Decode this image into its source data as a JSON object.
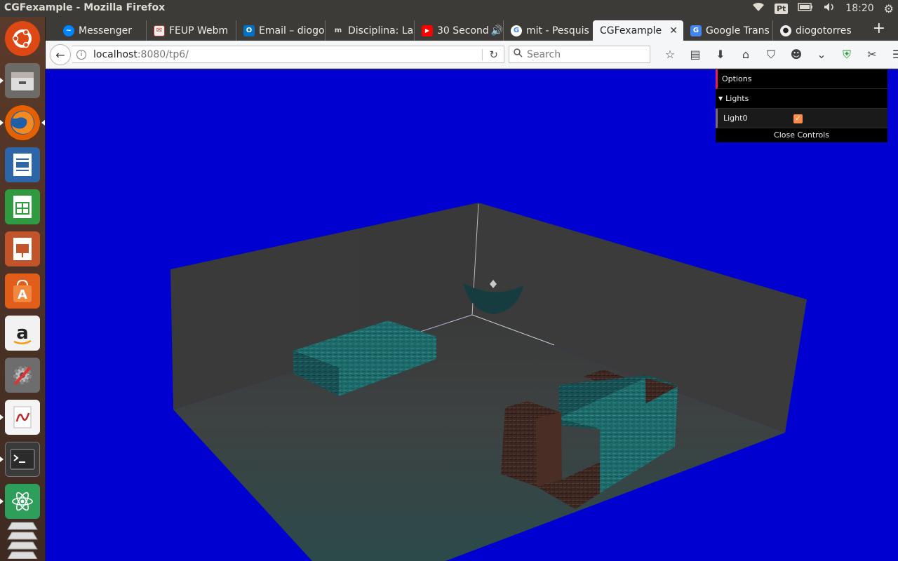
{
  "system_bar": {
    "window_title": "CGFexample - Mozilla Firefox",
    "keyboard_layout": "Pt",
    "clock": "18:20"
  },
  "launcher": {
    "items": [
      "ubuntu-dash",
      "files",
      "firefox",
      "writer",
      "calc",
      "impress",
      "software-center",
      "amazon",
      "system-settings",
      "document-viewer",
      "terminal",
      "atom",
      "workspaces"
    ]
  },
  "browser": {
    "tabs": [
      {
        "label": "Messenger",
        "icon": "messenger-icon",
        "color": "#0084ff"
      },
      {
        "label": "FEUP Webm",
        "icon": "mail-icon",
        "color": "#c0392b"
      },
      {
        "label": "Email – diogo",
        "icon": "outlook-icon",
        "color": "#0072c6"
      },
      {
        "label": "Disciplina: La",
        "icon": "moodle-icon",
        "color": "#555555"
      },
      {
        "label": "30 Second",
        "icon": "youtube-icon",
        "color": "#ff0000"
      },
      {
        "label": "mit - Pesquis",
        "icon": "google-icon",
        "color": "#4285f4"
      },
      {
        "label": "CGFexample",
        "icon": "",
        "color": "#ffffff",
        "active": true
      },
      {
        "label": "Google Trans",
        "icon": "translate-icon",
        "color": "#4285f4"
      },
      {
        "label": "diogotorres",
        "icon": "github-icon",
        "color": "#222222"
      }
    ],
    "url": {
      "host": "localhost",
      "rest": ":8080/tp6/"
    },
    "search_placeholder": "Search"
  },
  "gui": {
    "title": "Options",
    "folder": "Lights",
    "controls": [
      {
        "label": "Light0",
        "checked": true
      }
    ],
    "close_label": "Close Controls"
  },
  "colors": {
    "background": "#0000d0",
    "accent": "#e61d5f",
    "checkbox": "#ff8c4a"
  }
}
